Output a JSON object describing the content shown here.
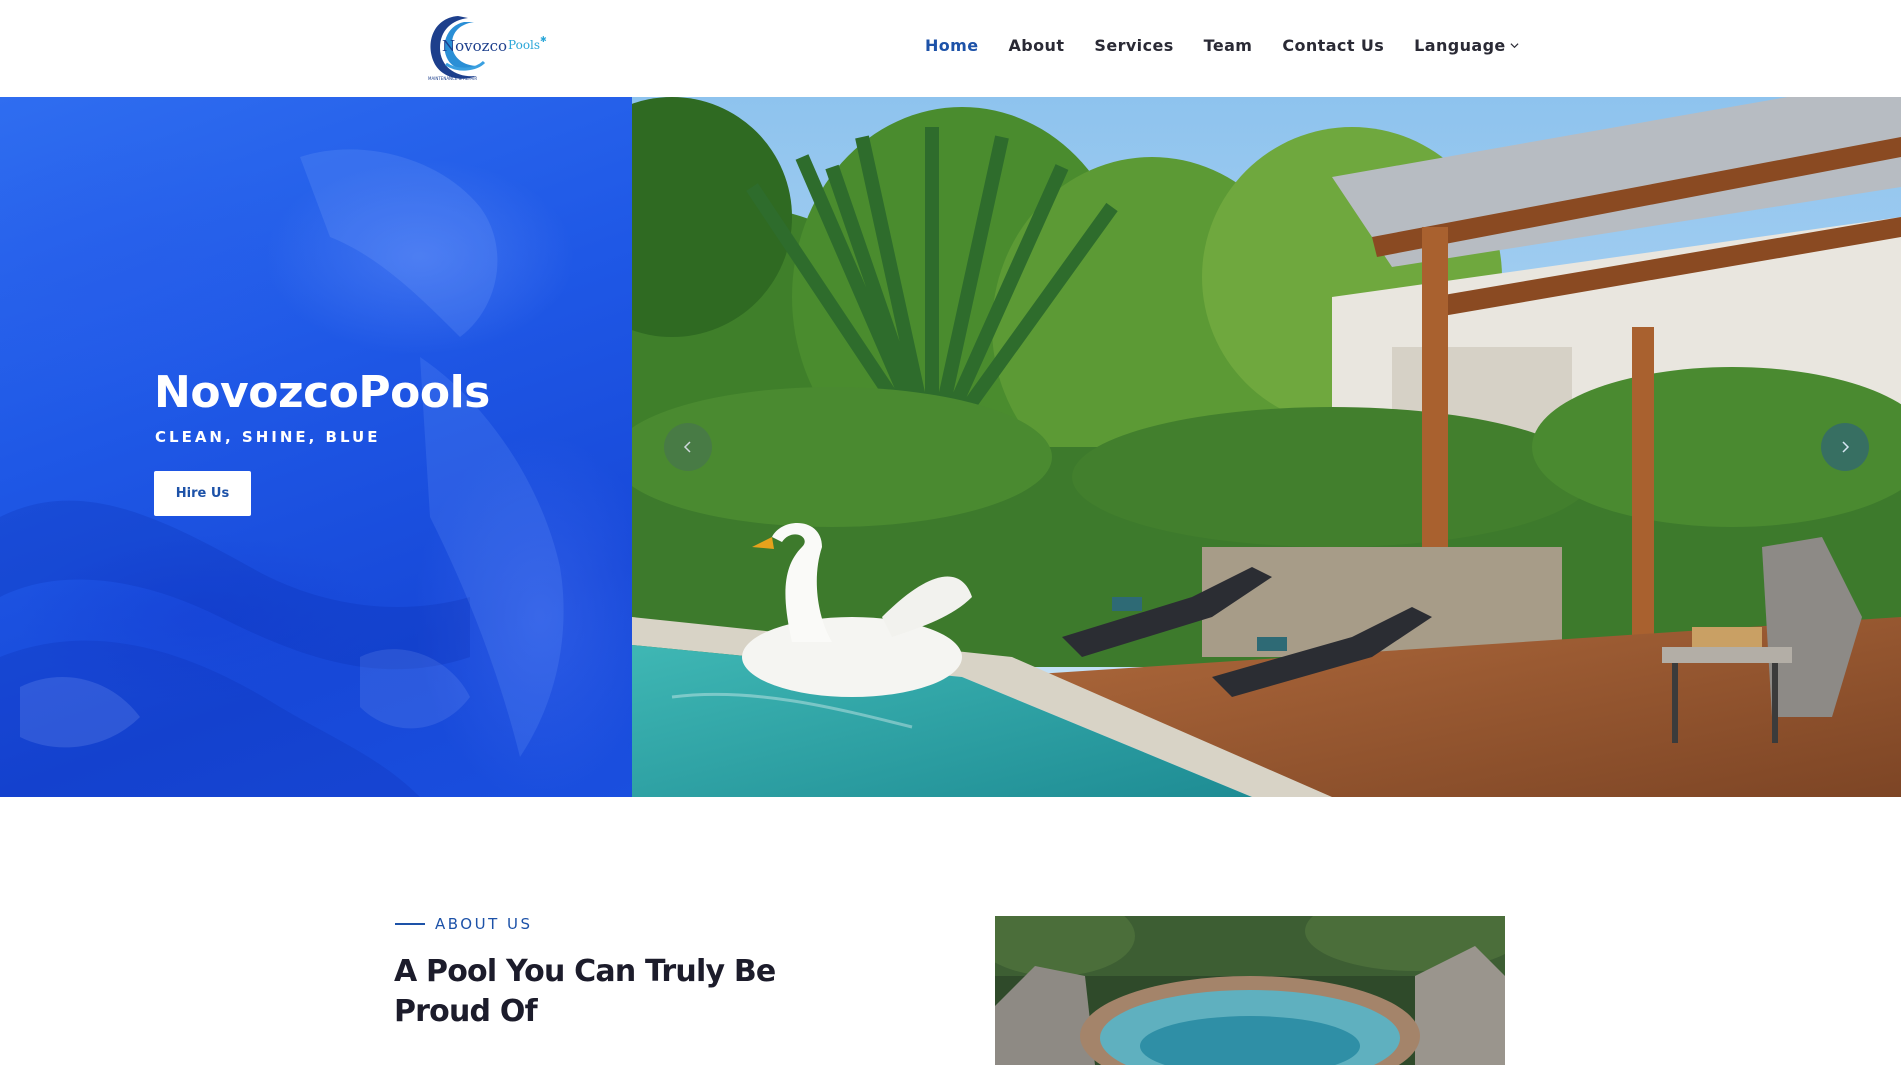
{
  "brand": {
    "logo_text": "Novozco Pools",
    "logo_tagline": "MAINTENANCE & REPAIR",
    "logo_alt": "Novozco Pools logo"
  },
  "nav": {
    "items": [
      {
        "label": "Home",
        "active": true
      },
      {
        "label": "About",
        "active": false
      },
      {
        "label": "Services",
        "active": false
      },
      {
        "label": "Team",
        "active": false
      },
      {
        "label": "Contact Us",
        "active": false
      },
      {
        "label": "Language",
        "active": false,
        "dropdown": true
      }
    ]
  },
  "hero": {
    "title": "NovozcoPools",
    "subtitle": "CLEAN, SHINE, BLUE",
    "cta_label": "Hire Us",
    "slider": {
      "prev_icon": "chevron-left-icon",
      "next_icon": "chevron-right-icon"
    }
  },
  "about": {
    "eyebrow": "ABOUT US",
    "title": "A Pool You Can Truly Be Proud Of"
  },
  "colors": {
    "accent": "#1d52a8",
    "hero_blue": "#1f58e6",
    "text_dark": "#1c1c2b"
  }
}
